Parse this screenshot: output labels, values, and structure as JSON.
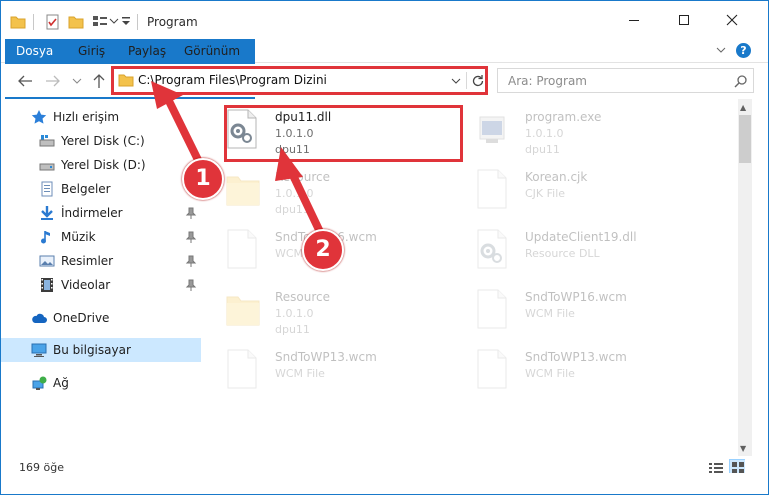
{
  "window": {
    "title": "Program"
  },
  "ribbon": {
    "tabs": [
      {
        "label": "Dosya"
      },
      {
        "label": "Giriş"
      },
      {
        "label": "Paylaş"
      },
      {
        "label": "Görünüm"
      }
    ]
  },
  "nav": {
    "address": "C:\\Program Files\\Program Dizini",
    "search_placeholder": "Ara: Program"
  },
  "sidebar": {
    "items": [
      {
        "label": "Hızlı erişim"
      },
      {
        "label": "Yerel Disk (C:)"
      },
      {
        "label": "Yerel Disk (D:)"
      },
      {
        "label": "Belgeler"
      },
      {
        "label": "İndirmeler"
      },
      {
        "label": "Müzik"
      },
      {
        "label": "Resimler"
      },
      {
        "label": "Videolar"
      },
      {
        "label": "OneDrive"
      },
      {
        "label": "Bu bilgisayar"
      },
      {
        "label": "Ağ"
      }
    ]
  },
  "files": [
    {
      "name": "dpu11.dll",
      "line1": "1.0.1.0",
      "line2": "dpu11",
      "icon": "gear-file-icon"
    },
    {
      "name": "program.exe",
      "line1": "1.0.1.0",
      "line2": "dpu11",
      "icon": "exe-icon"
    },
    {
      "name": "Resource",
      "line1": "1.0.1.0",
      "line2": "dpu11",
      "icon": "folder-icon"
    },
    {
      "name": "Korean.cjk",
      "line1": "CJK File",
      "line2": "",
      "icon": "blank-file-icon"
    },
    {
      "name": "SndToWP16.wcm",
      "line1": "WCM File",
      "line2": "",
      "icon": "blank-file-icon"
    },
    {
      "name": "UpdateClient19.dll",
      "line1": "Resource DLL",
      "line2": "",
      "icon": "gear-file-icon"
    },
    {
      "name": "Resource",
      "line1": "1.0.1.0",
      "line2": "dpu11",
      "icon": "folder-icon"
    },
    {
      "name": "SndToWP16.wcm",
      "line1": "WCM File",
      "line2": "",
      "icon": "blank-file-icon"
    },
    {
      "name": "SndToWP13.wcm",
      "line1": "WCM File",
      "line2": "",
      "icon": "blank-file-icon"
    },
    {
      "name": "SndToWP13.wcm",
      "line1": "WCM File",
      "line2": "",
      "icon": "blank-file-icon"
    }
  ],
  "status": {
    "count": "169 öğe"
  },
  "annotations": {
    "step1": "1",
    "step2": "2"
  },
  "colors": {
    "accent": "#1979ca",
    "highlight": "#e0343a",
    "selected": "#cce8ff"
  }
}
